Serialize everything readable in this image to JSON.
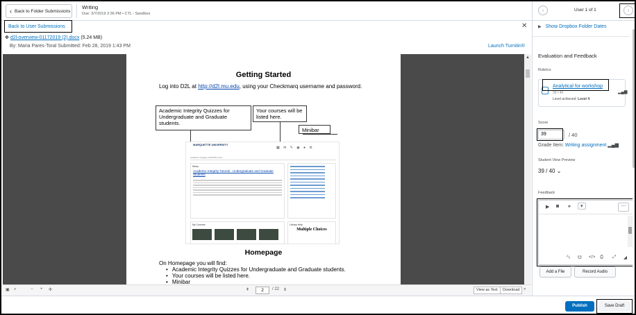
{
  "header": {
    "back_folder": "Back to Folder Submissions",
    "title": "Writing",
    "subtitle": "Due: 3/7/2019 2:36 PM • CTL - Sandbox",
    "user_of": "User 1 of 1",
    "prev_icon": "chevron-left",
    "next_icon": "chevron-right"
  },
  "submission": {
    "back_label": "Back to User Submissions",
    "file_name": "d2l-overview-01172019 (2).docx",
    "file_size": "(5.24 MB)",
    "byline": "By: Maria Pares-Toral  Submitted: Feb 28, 2019 1:43 PM",
    "turnitin": "Launch Turnitin®"
  },
  "document": {
    "heading": "Getting Started",
    "intro_pre": "Log into D2L at ",
    "intro_link": "http://d2l.mu.edu",
    "intro_post": ", using your Checkmarq username and password.",
    "callout1": "Academic Integrity Quizzes for Undergraduate and Graduate students.",
    "callout2": "Your courses will be listed here.",
    "callout3": "Minibar",
    "shot_logo": "MARQUETTE UNIVERSITY",
    "shot_nav": "Academic Integrity    eSSIXWs    Lines",
    "shot_news": "News",
    "shot_news_title": "Academic Integrity Tutorial - Undergraduate and Graduate Students",
    "shot_courses": "My Courses",
    "shot_library": "Library Help",
    "shot_multiple": "Multiple Choices",
    "heading2": "Homepage",
    "body2": "On Homepage you will find:",
    "bullets": [
      "Academic Integrity Quizzes for Undergraduate and Graduate students.",
      "Your courses will be listed here.",
      "Minibar"
    ]
  },
  "viewer_toolbar": {
    "page": "2",
    "page_total": "/ 22",
    "view_as_text": "View as Text",
    "download": "Download"
  },
  "panel": {
    "show_dates": "Show Dropbox Folder Dates",
    "eval_heading": "Evaluation and Feedback",
    "rubrics_label": "Rubrics",
    "rubric_name": "Analytical for workshop",
    "rubric_score": "39 / 40",
    "rubric_level_label": "Level achieved:",
    "rubric_level": "Level 4",
    "score_label": "Score",
    "score_value": "39",
    "score_out_of": "/ 40",
    "grade_item_label": "Grade Item:",
    "grade_item": "Writing assignment",
    "svp_label": "Student View Preview",
    "svp_value": "39 / 40",
    "feedback_label": "Feedback",
    "add_file": "Add a File",
    "record_audio": "Record Audio"
  },
  "footer": {
    "publish": "Publish",
    "save_draft": "Save Draft"
  }
}
